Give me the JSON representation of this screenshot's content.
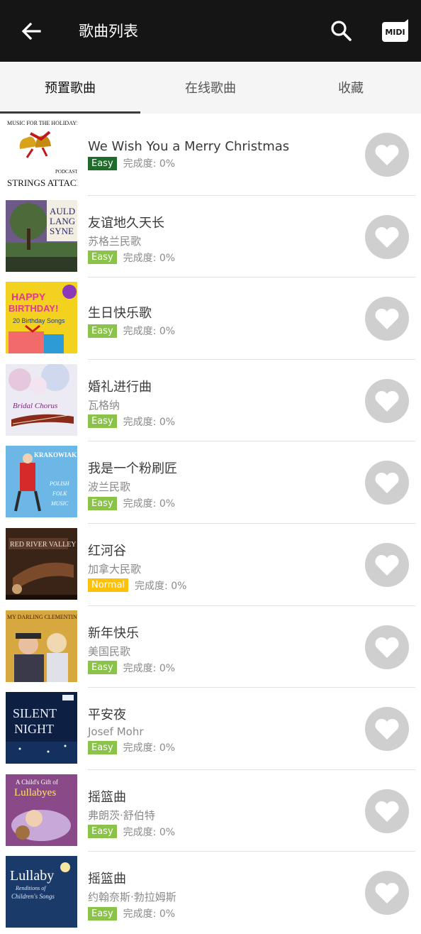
{
  "header": {
    "title": "歌曲列表",
    "back_icon": "back-arrow-icon",
    "search_icon": "search-icon",
    "midi_label": "MIDI"
  },
  "tabs": [
    {
      "label": "预置歌曲",
      "active": true
    },
    {
      "label": "在线歌曲",
      "active": false
    },
    {
      "label": "收藏",
      "active": false
    }
  ],
  "progress_label": "完成度: ",
  "songs": [
    {
      "title": "We Wish You a Merry Christmas",
      "artist": "",
      "level": "Easy",
      "level_color": "#1f6b2a",
      "progress": "0%",
      "cover_text": "Music for the Holidays / Podcast / Strings Attached"
    },
    {
      "title": "友谊地久天长",
      "artist": "苏格兰民歌",
      "level": "Easy",
      "level_color": "#8bc34a",
      "progress": "0%",
      "cover_text": "Auld Lang Syne"
    },
    {
      "title": "生日快乐歌",
      "artist": "",
      "level": "Easy",
      "level_color": "#8bc34a",
      "progress": "0%",
      "cover_text": "Happy Birthday! 20 Birthday Songs"
    },
    {
      "title": "婚礼进行曲",
      "artist": "瓦格纳",
      "level": "Easy",
      "level_color": "#8bc34a",
      "progress": "0%",
      "cover_text": "Bridal Chorus"
    },
    {
      "title": "我是一个粉刷匠",
      "artist": "波兰民歌",
      "level": "Easy",
      "level_color": "#8bc34a",
      "progress": "0%",
      "cover_text": "Krakowiaki Polish Folk Music"
    },
    {
      "title": "红河谷",
      "artist": "加拿大民歌",
      "level": "Normal",
      "level_color": "#ffc107",
      "progress": "0%",
      "cover_text": "Red River Valley"
    },
    {
      "title": "新年快乐",
      "artist": "美国民歌",
      "level": "Easy",
      "level_color": "#8bc34a",
      "progress": "0%",
      "cover_text": "My Darling Clementine"
    },
    {
      "title": "平安夜",
      "artist": "Josef Mohr",
      "level": "Easy",
      "level_color": "#8bc34a",
      "progress": "0%",
      "cover_text": "Silent Night"
    },
    {
      "title": "摇篮曲",
      "artist": "弗朗茨·舒伯特",
      "level": "Easy",
      "level_color": "#8bc34a",
      "progress": "0%",
      "cover_text": "A Child's Gift of Lullabyes"
    },
    {
      "title": "摇篮曲",
      "artist": "约翰奈斯·勃拉姆斯",
      "level": "Easy",
      "level_color": "#8bc34a",
      "progress": "0%",
      "cover_text": "Lullaby Renditions of Children's Songs"
    }
  ],
  "colors": {
    "appbar": "#151515",
    "tab_bg": "#f5f5f5",
    "fav_bg": "#cfcfcf"
  }
}
